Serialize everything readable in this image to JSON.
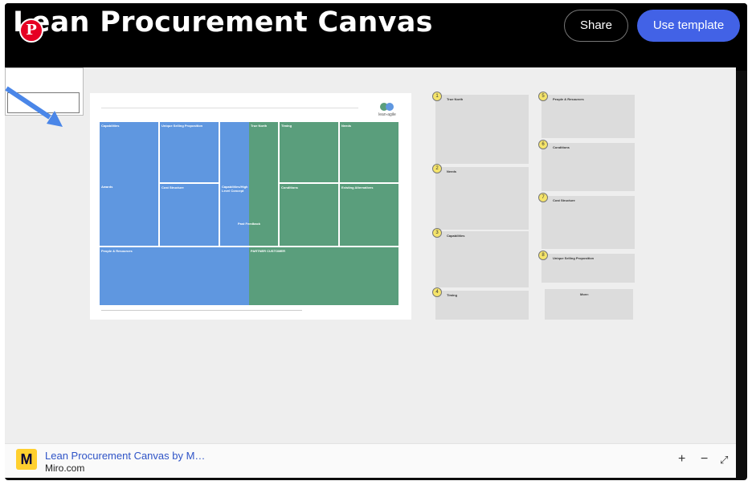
{
  "header": {
    "title": "Lean Procurement Canvas",
    "share_label": "Share",
    "use_template_label": "Use template"
  },
  "pin_letter": "P",
  "canvas": {
    "cells": {
      "capabilities": "Capabilities",
      "usp": "Unique Selling Proposition",
      "true_north": "True North",
      "timing": "Timing",
      "needs": "Needs",
      "awards": "Awards",
      "cost_structure": "Cost Structure",
      "capabilities_level": "Capabilities/High Level Concept",
      "conditions": "Conditions",
      "existing_alternatives": "Existing Alternatives",
      "past_feedback": "Past Feedback",
      "people_resources": "People & Resources",
      "partner_customer": "PARTNER  CUSTOMER"
    },
    "logo_text": "lean-agile"
  },
  "notes": {
    "num_1": "1",
    "num_2": "2",
    "num_3": "3",
    "num_4": "4",
    "num_5": "5",
    "num_6": "6",
    "num_7": "7",
    "num_8": "8",
    "h_1": "True North",
    "h_2": "Needs",
    "h_3": "Capabilities",
    "h_4": "Timing",
    "h_5": "People & Resources",
    "h_6": "Conditions",
    "h_7": "Cost Structure",
    "h_8": "Unique Selling Proposition",
    "h_more": "More:"
  },
  "footer": {
    "title": "Lean Procurement Canvas by M…",
    "domain": "Miro.com",
    "miro_logo": "M",
    "zoom_in": "+",
    "zoom_out": "−",
    "expand": "⤢"
  },
  "colors": {
    "brand_blue": "#4262e6",
    "canvas_blue": "#5f97e0",
    "canvas_green": "#5a9e7c",
    "note_yellow": "#f5e46a"
  }
}
